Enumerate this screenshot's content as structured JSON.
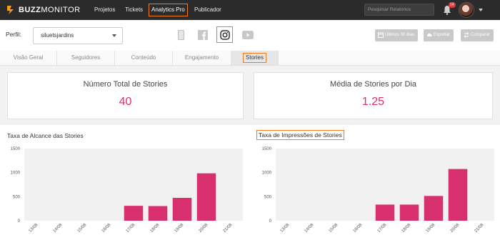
{
  "topbar": {
    "brand_bold": "BUZZ",
    "brand_thin": "MONITOR",
    "nav": [
      {
        "label": "Projetos"
      },
      {
        "label": "Tickets"
      },
      {
        "label": "Analytics Pro"
      },
      {
        "label": "Publicador"
      }
    ],
    "search_placeholder": "Pesquisar Relatórios",
    "notification_count": "14",
    "active_color": "#f07a1e"
  },
  "profile": {
    "label": "Perfil:",
    "selected": "siluetsjardins",
    "networks": [
      "mobile-icon",
      "facebook-icon",
      "instagram-icon",
      "youtube-icon"
    ],
    "buttons": {
      "period": "Últimos 30 dias",
      "export": "Exportar",
      "compare": "Comparar"
    }
  },
  "tabs": [
    "Visão Geral",
    "Seguidores",
    "Conteúdo",
    "Engajamento",
    "Stories"
  ],
  "stats": {
    "total_title": "Número Total de Stories",
    "total_value": "40",
    "avg_title": "Média de Stories por Dia",
    "avg_value": "1.25",
    "value_color": "#d8306f"
  },
  "chart_data": [
    {
      "type": "bar",
      "title": "Taxa de Alcance das Stories",
      "categories": [
        "13/08",
        "14/08",
        "15/08",
        "16/08",
        "17/08",
        "18/08",
        "19/08",
        "20/08",
        "21/08"
      ],
      "values": [
        0,
        0,
        0,
        0,
        310,
        305,
        475,
        985,
        0
      ],
      "ylim": [
        0,
        1500
      ],
      "yticks": [
        0,
        500,
        1000,
        1500
      ],
      "color": "#d8306f",
      "grid": false
    },
    {
      "type": "bar",
      "title": "Taxa de Impressões de Stories",
      "categories": [
        "13/08",
        "14/08",
        "15/08",
        "16/08",
        "17/08",
        "18/08",
        "19/08",
        "20/08",
        "21/08"
      ],
      "values": [
        0,
        0,
        0,
        0,
        335,
        335,
        515,
        1075,
        0
      ],
      "ylim": [
        0,
        1500
      ],
      "yticks": [
        0,
        500,
        1000,
        1500
      ],
      "color": "#d8306f",
      "grid": false
    }
  ]
}
